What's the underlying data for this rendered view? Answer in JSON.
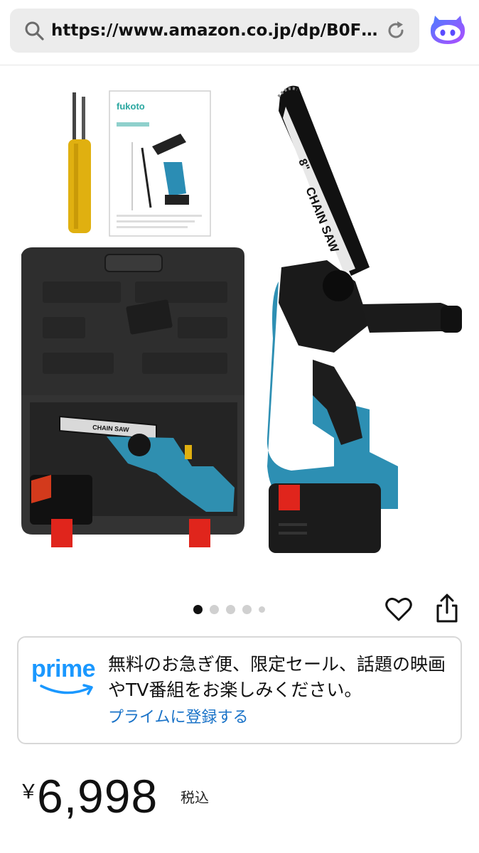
{
  "browser": {
    "url": "https://www.amazon.co.jp/dp/B0FPQ..."
  },
  "carousel": {
    "total": 5,
    "active_index": 0
  },
  "prime": {
    "logo_text": "prime",
    "message": "無料のお急ぎ便、限定セール、話題の映画やTV番組をお楽しみください。",
    "link": "プライムに登録する",
    "brand_color": "#1a98ff"
  },
  "product_image": {
    "manual_brand": "fukoto",
    "chain_label": "CHAIN SAW",
    "bar_label": "8\""
  },
  "price": {
    "symbol": "￥",
    "value": "6,998",
    "tax": "税込"
  },
  "icons": {
    "search": "search-icon",
    "reload": "reload-icon",
    "extension": "assistant-extension-icon",
    "favorite": "heart-icon",
    "share": "share-icon"
  }
}
